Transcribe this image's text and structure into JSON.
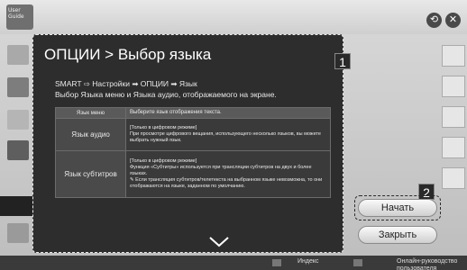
{
  "app": {
    "logo_text": "User\nGuide"
  },
  "topbar": {
    "back_icon": "back-icon",
    "close_icon": "close-icon"
  },
  "dialog": {
    "title": "ОПЦИИ > Выбор языка",
    "path_text": "SMART ⇨ Настройки ➡ ОПЦИИ ➡ Язык",
    "description": "Выбор Языка меню и Языка аудио, отображаемого на экране.",
    "table": {
      "rows": [
        {
          "label": "Язык меню",
          "text": "Выберите язык отображения текста."
        },
        {
          "label": "Язык аудио",
          "text": "[Только в цифровом режиме]\nПри просмотре цифрового вещания, использующего несколько языков, вы можете выбрать нужный язык."
        },
        {
          "label": "Язык субтитров",
          "text": "[Только в цифровом режиме]\nФункция «Субтитры» используется при трансляции субтитров на двух и более языках.\n✎ Если трансляция субтитров/телетекста на выбранном языке невозможна, то они отображаются на языке, заданном по умолчанию."
        }
      ]
    },
    "badge1": "1",
    "badge2": "2"
  },
  "buttons": {
    "start_label": "Начать",
    "close_label": "Закрыть"
  },
  "bottombar": {
    "index_label": "Индекс",
    "online_label": "Онлайн-руководство пользователя"
  }
}
